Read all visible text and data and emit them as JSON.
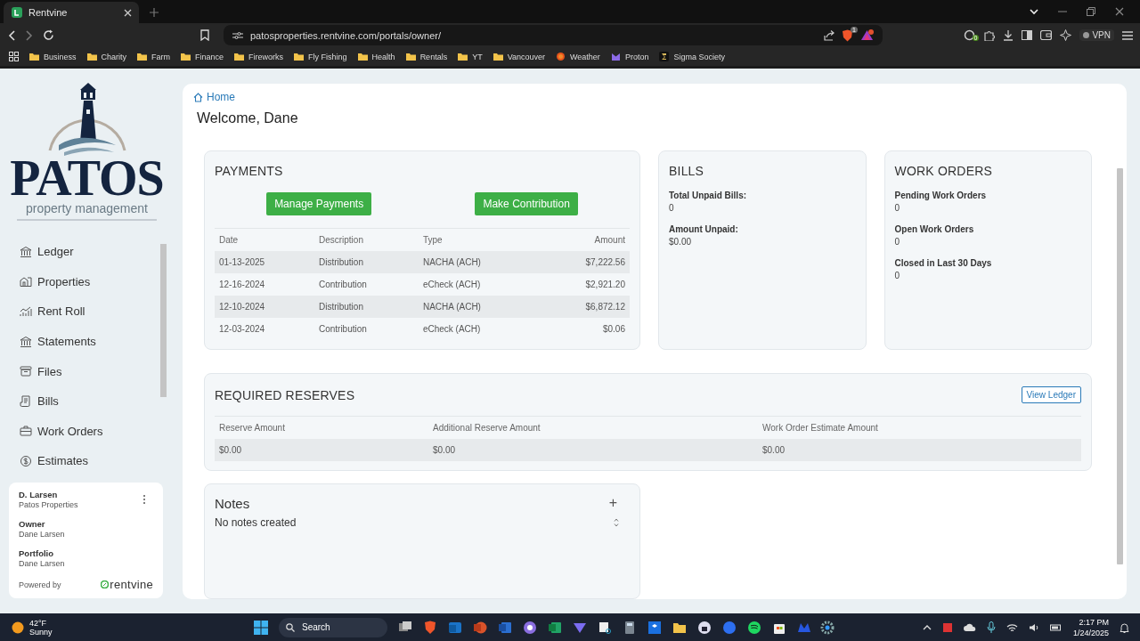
{
  "browser": {
    "tabs": [
      {
        "title": "Rentvine",
        "selected": true
      }
    ],
    "url": "patosproperties.rentvine.com/portals/owner/",
    "shields_badge": "1",
    "extensions_badge": "0",
    "vpn": "VPN",
    "bookmarks": [
      {
        "label": "Business",
        "kind": "folder"
      },
      {
        "label": "Charity",
        "kind": "folder"
      },
      {
        "label": "Farm",
        "kind": "folder"
      },
      {
        "label": "Finance",
        "kind": "folder"
      },
      {
        "label": "Fireworks",
        "kind": "folder"
      },
      {
        "label": "Fly Fishing",
        "kind": "folder"
      },
      {
        "label": "Health",
        "kind": "folder"
      },
      {
        "label": "Rentals",
        "kind": "folder"
      },
      {
        "label": "YT",
        "kind": "folder"
      },
      {
        "label": "Vancouver",
        "kind": "folder"
      },
      {
        "label": "Weather",
        "kind": "sun"
      },
      {
        "label": "Proton",
        "kind": "proton"
      },
      {
        "label": "Sigma Society",
        "kind": "sigma"
      }
    ]
  },
  "sidebar": {
    "logo": {
      "name": "PATOS",
      "tagline": "property management"
    },
    "nav": [
      {
        "label": "Ledger"
      },
      {
        "label": "Properties"
      },
      {
        "label": "Rent Roll"
      },
      {
        "label": "Statements"
      },
      {
        "label": "Files"
      },
      {
        "label": "Bills"
      },
      {
        "label": "Work Orders"
      },
      {
        "label": "Estimates"
      }
    ],
    "user_card": {
      "name": "D. Larsen",
      "company": "Patos Properties",
      "fields": [
        {
          "label": "Owner",
          "value": "Dane Larsen"
        },
        {
          "label": "Portfolio",
          "value": "Dane Larsen"
        }
      ],
      "powered_by": "Powered by",
      "brand": "rentvine"
    }
  },
  "breadcrumb": "Home",
  "welcome": "Welcome, Dane",
  "payments": {
    "title": "PAYMENTS",
    "buttons": [
      "Manage Payments",
      "Make Contribution"
    ],
    "columns": [
      "Date",
      "Description",
      "Type",
      "Amount"
    ],
    "rows": [
      [
        "01-13-2025",
        "Distribution",
        "NACHA (ACH)",
        "$7,222.56"
      ],
      [
        "12-16-2024",
        "Contribution",
        "eCheck (ACH)",
        "$2,921.20"
      ],
      [
        "12-10-2024",
        "Distribution",
        "NACHA (ACH)",
        "$6,872.12"
      ],
      [
        "12-03-2024",
        "Contribution",
        "eCheck (ACH)",
        "$0.06"
      ]
    ]
  },
  "bills": {
    "title": "BILLS",
    "stats": [
      {
        "label": "Total Unpaid Bills:",
        "value": "0"
      },
      {
        "label": "Amount Unpaid:",
        "value": "$0.00"
      }
    ]
  },
  "work_orders": {
    "title": "WORK ORDERS",
    "stats": [
      {
        "label": "Pending Work Orders",
        "value": "0"
      },
      {
        "label": "Open Work Orders",
        "value": "0"
      },
      {
        "label": "Closed in Last 30 Days",
        "value": "0"
      }
    ]
  },
  "reserves": {
    "title": "REQUIRED RESERVES",
    "button": "View Ledger",
    "columns": [
      "Reserve Amount",
      "Additional Reserve Amount",
      "Work Order Estimate Amount"
    ],
    "rows": [
      [
        "$0.00",
        "$0.00",
        "$0.00"
      ]
    ]
  },
  "notes": {
    "title": "Notes",
    "add": "+",
    "empty": "No notes created"
  },
  "taskbar": {
    "weather": {
      "temp": "42°F",
      "condition": "Sunny"
    },
    "search": "Search",
    "time": "2:17 PM",
    "date": "1/24/2025"
  }
}
